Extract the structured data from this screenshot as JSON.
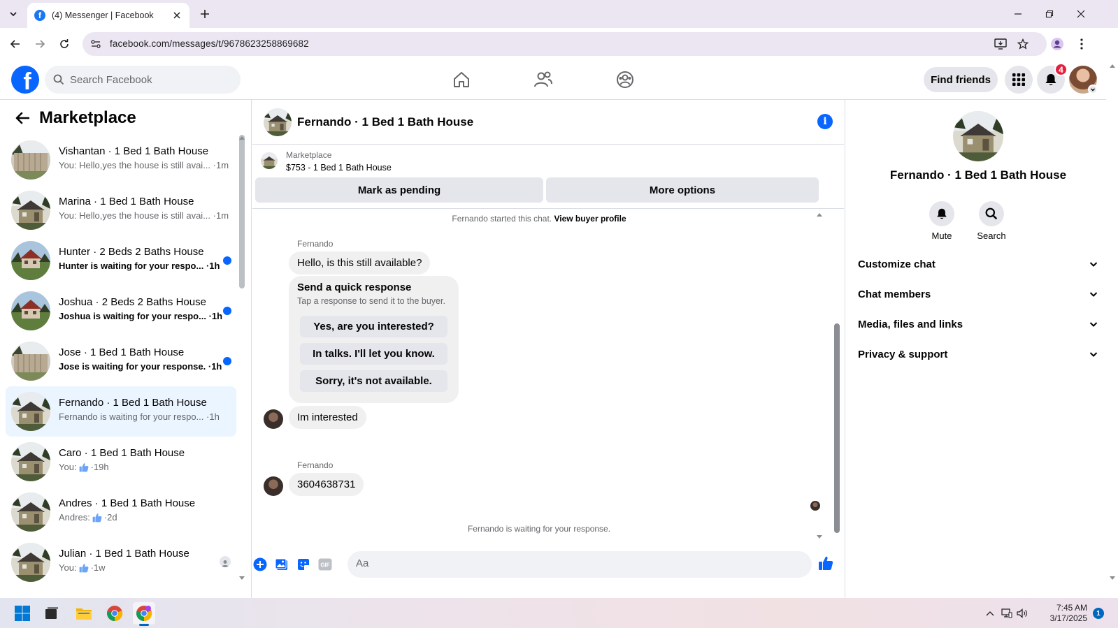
{
  "browser": {
    "tab_title": "(4) Messenger | Facebook",
    "url": "facebook.com/messages/t/9678623258869682"
  },
  "fb": {
    "search_placeholder": "Search Facebook",
    "find_friends": "Find friends",
    "notification_count": "4",
    "brand_color": "#0866ff"
  },
  "sidebar": {
    "title": "Marketplace",
    "conversations": [
      {
        "name": "Vishantan · 1 Bed 1 Bath House",
        "preview": "You: Hello,yes the house is still avai...",
        "time": "1m",
        "unread": false
      },
      {
        "name": "Marina · 1 Bed 1 Bath House",
        "preview": "You: Hello,yes the house is still avai...",
        "time": "1m",
        "unread": false
      },
      {
        "name": "Hunter · 2 Beds 2 Baths House",
        "preview": "Hunter is waiting for your respo...",
        "time": "1h",
        "unread": true
      },
      {
        "name": "Joshua · 2 Beds 2 Baths House",
        "preview": "Joshua is waiting for your respo...",
        "time": "1h",
        "unread": true
      },
      {
        "name": "Jose · 1 Bed 1 Bath House",
        "preview": "Jose is waiting for your response.",
        "time": "1h",
        "unread": true
      },
      {
        "name": "Fernando · 1 Bed 1 Bath House",
        "preview": "Fernando is waiting for your respo...",
        "time": "1h",
        "unread": false,
        "active": true
      },
      {
        "name": "Caro · 1 Bed 1 Bath House",
        "preview": "You:",
        "time": "19h",
        "unread": false
      },
      {
        "name": "Andres · 1 Bed 1 Bath House",
        "preview": "Andres:",
        "time": "2d",
        "unread": false
      },
      {
        "name": "Julian · 1 Bed 1 Bath House",
        "preview": "You:",
        "time": "1w",
        "unread": false
      }
    ]
  },
  "chat": {
    "title": "Fernando · 1 Bed 1 Bath House",
    "listing_label": "Marketplace",
    "listing_price": "$753 - 1 Bed 1 Bath House",
    "mark_pending": "Mark as pending",
    "more_options": "More options",
    "started_text": "Fernando started this chat.",
    "view_buyer": "View buyer profile",
    "sender_name": "Fernando",
    "msg1": "Hello, is this still available?",
    "quick_title": "Send a quick response",
    "quick_sub": "Tap a response to send it to the buyer.",
    "quick_options": [
      "Yes, are you interested?",
      "In talks. I'll let you know.",
      "Sorry, it's not available."
    ],
    "msg2": "Im interested",
    "msg3": "3604638731",
    "waiting_text": "Fernando is waiting for your response.",
    "input_placeholder": "Aa"
  },
  "details": {
    "name": "Fernando · 1 Bed 1 Bath House",
    "mute": "Mute",
    "search": "Search",
    "sections": [
      "Customize chat",
      "Chat members",
      "Media, files and links",
      "Privacy & support"
    ]
  },
  "taskbar": {
    "time": "7:45 AM",
    "date": "3/17/2025",
    "notification_count": "1"
  }
}
